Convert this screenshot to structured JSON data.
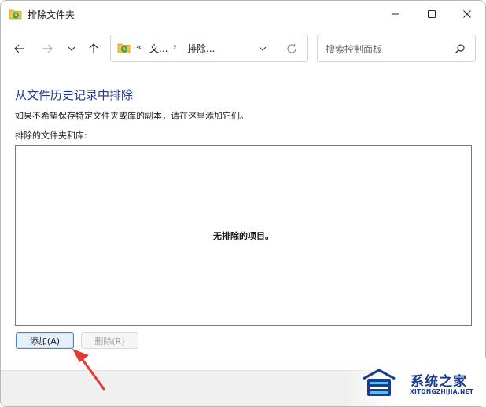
{
  "window": {
    "title": "排除文件夹"
  },
  "navigation": {
    "back_icon": "arrow-left-icon",
    "forward_icon": "arrow-right-icon",
    "recent_icon": "chevron-down-icon",
    "up_icon": "arrow-up-icon"
  },
  "address_bar": {
    "overflow": "«",
    "crumbs": [
      "文...",
      "排除..."
    ],
    "separator": "›"
  },
  "search": {
    "placeholder": "搜索控制面板"
  },
  "main": {
    "heading": "从文件历史记录中排除",
    "description": "如果不希望保存特定文件夹或库的副本，请在这里添加它们。",
    "list_label": "排除的文件夹和库:",
    "empty_text": "无排除的项目。"
  },
  "buttons": {
    "add_label": "添加(A)",
    "remove_label": "删除(R)"
  },
  "watermark": {
    "name": "系统之家",
    "url": "XITONGZHIJIA.NET"
  },
  "colors": {
    "heading": "#1e3a8a",
    "accent": "#3c8ad7",
    "arrow": "#e53935",
    "brand": "#1a3c8e"
  }
}
